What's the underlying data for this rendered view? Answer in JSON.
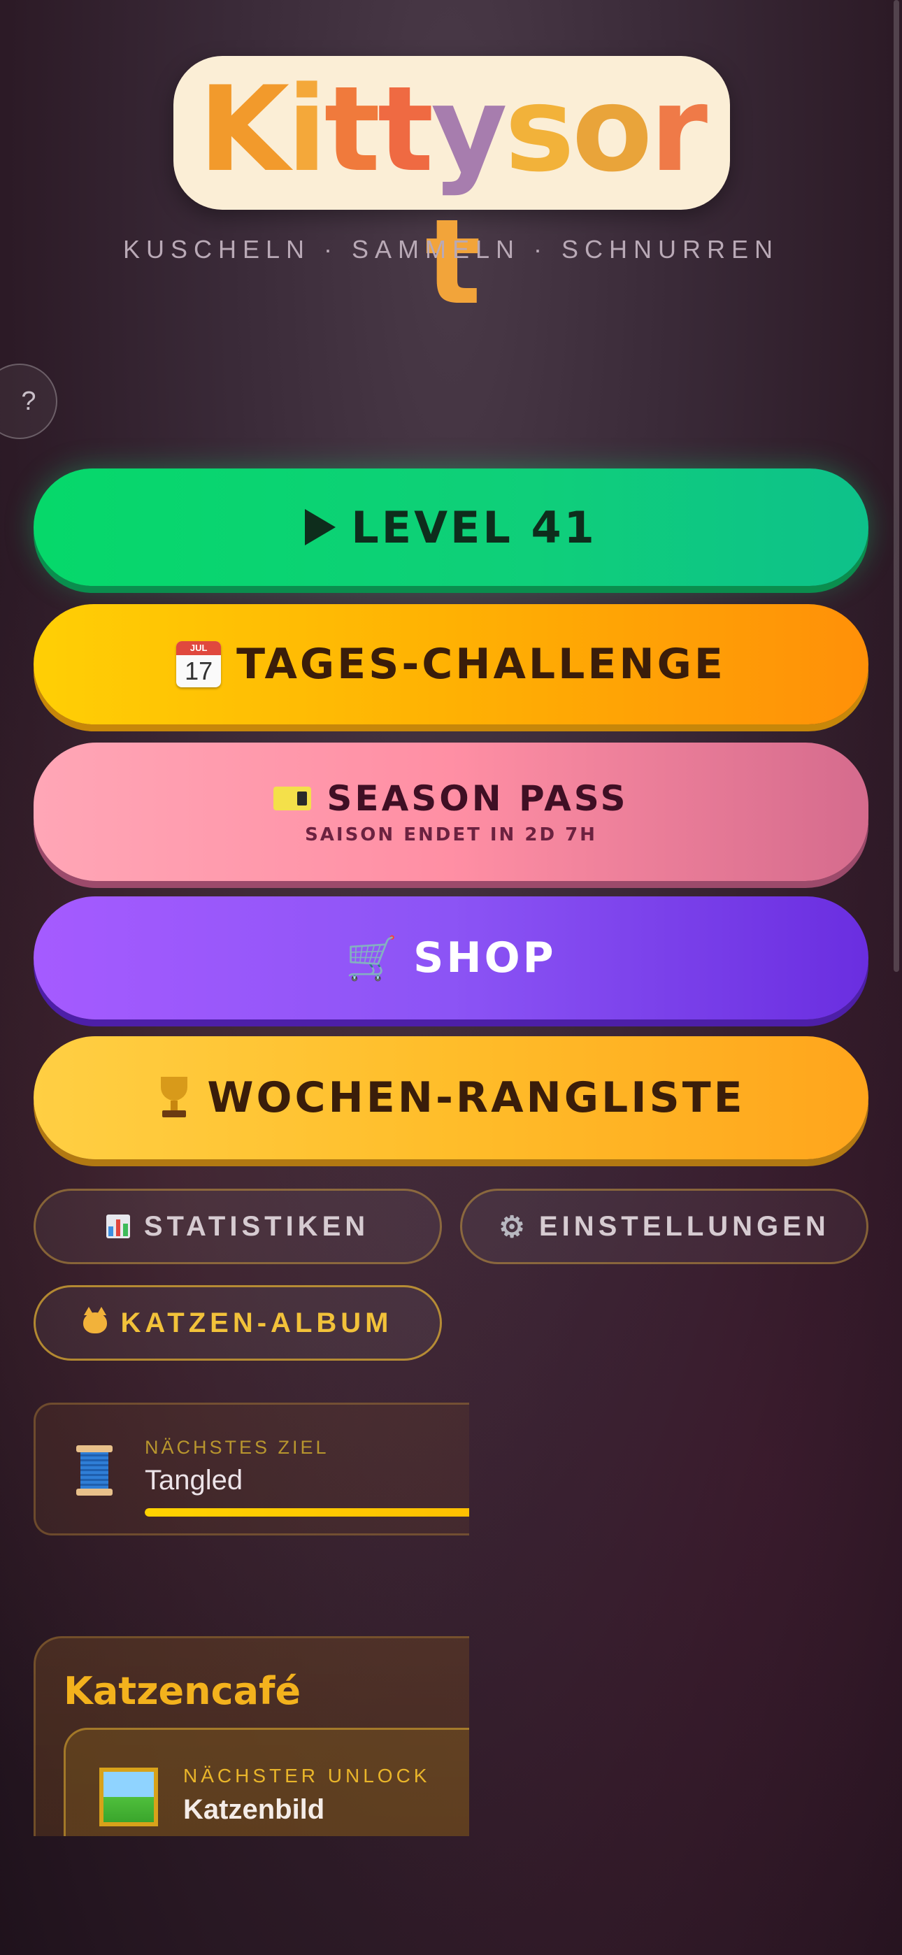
{
  "app": {
    "logo_letters": [
      "K",
      "i",
      "t",
      "t",
      "y",
      "s",
      "o",
      "r",
      "t"
    ],
    "tagline": "KUSCHELN · SAMMELN · SCHNURREN"
  },
  "help": {
    "label": "?"
  },
  "menu": {
    "level": {
      "label": "LEVEL 41",
      "icon": "play-icon"
    },
    "daily": {
      "label": "TAGES-CHALLENGE",
      "icon": "calendar-icon",
      "calendar_month": "JUL",
      "calendar_day": "17"
    },
    "season": {
      "label": "SEASON PASS",
      "sub": "SAISON ENDET IN 2D 7H",
      "icon": "ticket-icon"
    },
    "shop": {
      "label": "SHOP",
      "icon": "cart-icon",
      "icon_glyph": "🛒"
    },
    "weekly": {
      "label": "WOCHEN-RANGLISTE",
      "icon": "trophy-icon"
    }
  },
  "secondary": {
    "stats": {
      "label": "STATISTIKEN",
      "icon": "bar-chart-icon"
    },
    "settings": {
      "label": "EINSTELLUNGEN",
      "icon": "gear-icon",
      "icon_glyph": "⚙"
    },
    "album": {
      "label": "KATZEN-ALBUM",
      "icon": "cat-face-icon"
    }
  },
  "goal": {
    "label": "NÄCHSTES ZIEL",
    "name": "Tangled",
    "icon": "spool-icon",
    "progress": 1.0
  },
  "cafe": {
    "title": "Katzencafé",
    "unlock_label": "NÄCHSTER UNLOCK",
    "unlock_name": "Katzenbild",
    "unlock_icon": "framed-picture-icon"
  },
  "colors": {
    "level": "#06d86a",
    "daily": "#ffb103",
    "season": "#ff8fa4",
    "shop": "#8c54f5",
    "weekly": "#ffbd2a",
    "accent_gold": "#f3b21d"
  }
}
